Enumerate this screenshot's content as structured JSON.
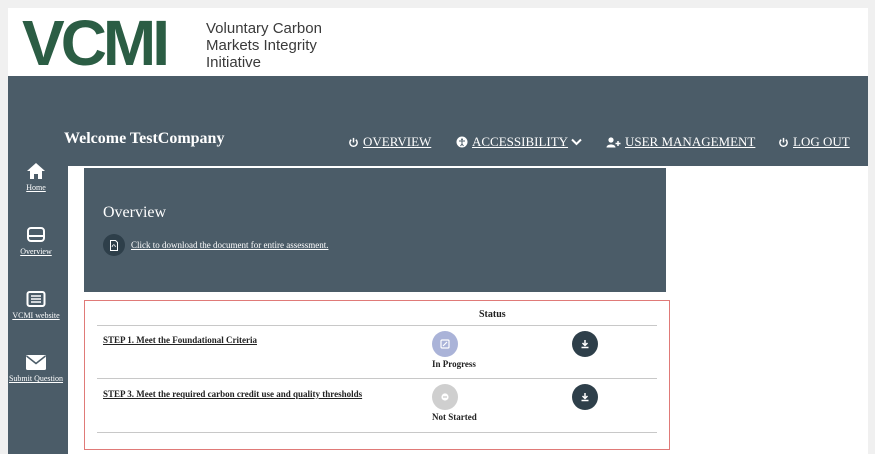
{
  "brand": {
    "logo_mark": "VCMI",
    "name_lines": [
      "Voluntary Carbon",
      "Markets Integrity",
      "Initiative"
    ],
    "color": "#2b5d44"
  },
  "header": {
    "welcome": "Welcome TestCompany",
    "nav": {
      "overview": "OVERVIEW",
      "accessibility": "ACCESSIBILITY",
      "user_management": "USER MANAGEMENT",
      "logout": "LOG OUT"
    }
  },
  "sidebar": {
    "items": [
      {
        "label": "Home",
        "icon": "home-icon"
      },
      {
        "label": "Overview",
        "icon": "inbox-icon"
      },
      {
        "label": "VCMI website",
        "icon": "list-icon"
      },
      {
        "label": "Submit Question",
        "icon": "envelope-icon"
      }
    ]
  },
  "overview": {
    "title": "Overview",
    "download_text": "Click to download the document for entire assessment."
  },
  "steps": {
    "status_header": "Status",
    "rows": [
      {
        "label": "STEP 1. Meet the Foundational Criteria",
        "status": "In Progress"
      },
      {
        "label": "STEP 3. Meet the required carbon credit use and quality thresholds",
        "status": "Not Started"
      }
    ]
  },
  "colors": {
    "panel": "#4b5c68",
    "button_dark": "#2e3f4a",
    "in_progress": "#aab3d8",
    "not_started": "#cfcfcf",
    "highlight_border": "#e07a78"
  }
}
